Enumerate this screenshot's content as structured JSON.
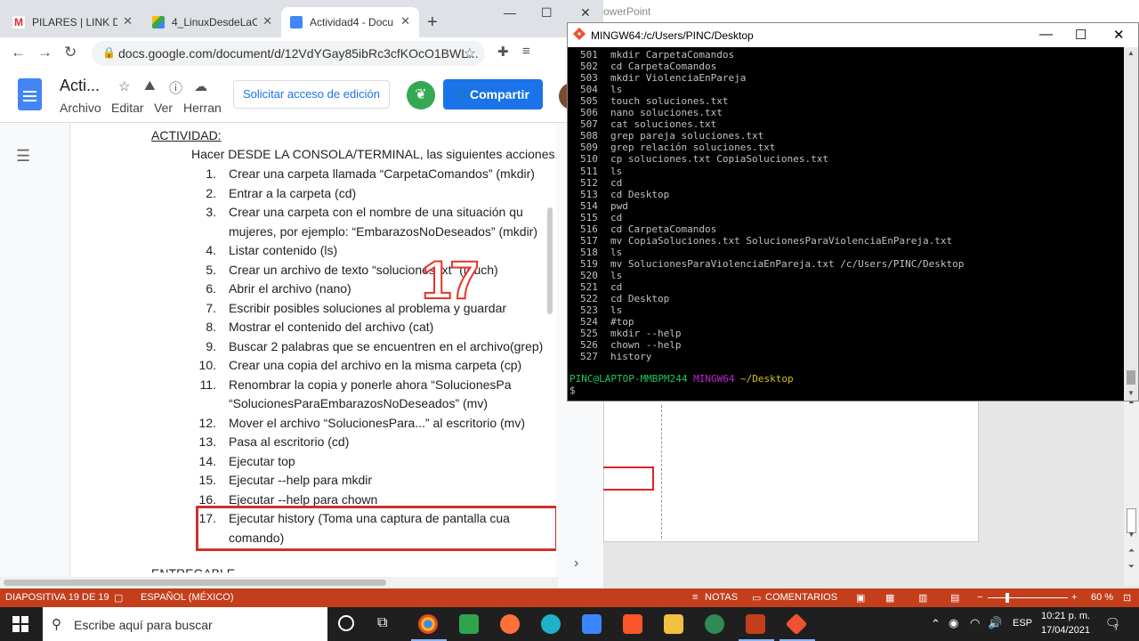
{
  "chrome": {
    "tabs": [
      {
        "label": "PILARES | LINK DE",
        "icon": "gmail-icon",
        "color": "#d93025",
        "active": false
      },
      {
        "label": "4_LinuxDesdeLaCo",
        "icon": "drive-icon",
        "color": "#34a853",
        "active": false
      },
      {
        "label": "Actividad4 - Docu",
        "icon": "docs-icon",
        "color": "#4285f4",
        "active": true
      }
    ],
    "new_tab": "+",
    "url": "docs.google.com/document/d/12VdYGay85ibRc3cfKOcO1BWL..."
  },
  "docs": {
    "title": "Acti...",
    "menus": [
      "Archivo",
      "Editar",
      "Ver",
      "Herran"
    ],
    "request_edit_label": "Solicitar acceso de edición",
    "share_label": "Compartir",
    "activity_title": "ACTIVIDAD:",
    "intro": "Hacer DESDE LA CONSOLA/TERMINAL, las siguientes acciones:",
    "items": [
      {
        "num": "1.",
        "lines": [
          "Crear una carpeta llamada “CarpetaComandos” (mkdir)"
        ]
      },
      {
        "num": "2.",
        "lines": [
          "Entrar a la carpeta (cd)"
        ]
      },
      {
        "num": "3.",
        "lines": [
          "Crear una carpeta con el nombre de una situación qu",
          "mujeres, por ejemplo: “EmbarazosNoDeseados” (mkdir)"
        ]
      },
      {
        "num": "4.",
        "lines": [
          "Listar contenido (ls)"
        ]
      },
      {
        "num": "5.",
        "lines": [
          "Crear un archivo de texto “soluciones.txt” (touch)"
        ]
      },
      {
        "num": "6.",
        "lines": [
          "Abrir el archivo (nano)"
        ]
      },
      {
        "num": "7.",
        "lines": [
          "Escribir posibles soluciones al problema y guardar"
        ]
      },
      {
        "num": "8.",
        "lines": [
          "Mostrar el contenido del archivo (cat)"
        ]
      },
      {
        "num": "9.",
        "lines": [
          "Buscar 2 palabras que se encuentren en el archivo(grep)"
        ]
      },
      {
        "num": "10.",
        "lines": [
          "Crear una copia del archivo en la misma carpeta (cp)"
        ]
      },
      {
        "num": "11.",
        "lines": [
          "Renombrar la copia y ponerle ahora “SolucionesPa",
          "“SolucionesParaEmbarazosNoDeseados” (mv)"
        ]
      },
      {
        "num": "12.",
        "lines": [
          "Mover el archivo “SolucionesPara...” al escritorio (mv)"
        ]
      },
      {
        "num": "13.",
        "lines": [
          "Pasa al escritorio (cd)"
        ]
      },
      {
        "num": "14.",
        "lines": [
          "Ejecutar top"
        ]
      },
      {
        "num": "15.",
        "lines": [
          "Ejecutar --help para mkdir"
        ]
      },
      {
        "num": "16.",
        "lines": [
          "Ejecutar --help para chown"
        ]
      },
      {
        "num": "17.",
        "lines": [
          "Ejecutar history (Toma una captura de pantalla cua",
          "comando)"
        ]
      }
    ],
    "overlay_number": "17",
    "entregable": "ENTREGABLE"
  },
  "terminal": {
    "title": "MINGW64:/c/Users/PINC/Desktop",
    "history": [
      {
        "n": "501",
        "cmd": "mkdir CarpetaComandos"
      },
      {
        "n": "502",
        "cmd": "cd CarpetaComandos"
      },
      {
        "n": "503",
        "cmd": "mkdir ViolenciaEnPareja"
      },
      {
        "n": "504",
        "cmd": "ls"
      },
      {
        "n": "505",
        "cmd": "touch soluciones.txt"
      },
      {
        "n": "506",
        "cmd": "nano soluciones.txt"
      },
      {
        "n": "507",
        "cmd": "cat soluciones.txt"
      },
      {
        "n": "508",
        "cmd": "grep pareja soluciones.txt"
      },
      {
        "n": "509",
        "cmd": "grep relación soluciones.txt"
      },
      {
        "n": "510",
        "cmd": "cp soluciones.txt CopiaSoluciones.txt"
      },
      {
        "n": "511",
        "cmd": "ls"
      },
      {
        "n": "512",
        "cmd": "cd"
      },
      {
        "n": "513",
        "cmd": "cd Desktop"
      },
      {
        "n": "514",
        "cmd": "pwd"
      },
      {
        "n": "515",
        "cmd": "cd"
      },
      {
        "n": "516",
        "cmd": "cd CarpetaComandos"
      },
      {
        "n": "517",
        "cmd": "mv CopiaSoluciones.txt SolucionesParaViolenciaEnPareja.txt"
      },
      {
        "n": "518",
        "cmd": "ls"
      },
      {
        "n": "519",
        "cmd": "mv SolucionesParaViolenciaEnPareja.txt /c/Users/PINC/Desktop"
      },
      {
        "n": "520",
        "cmd": "ls"
      },
      {
        "n": "521",
        "cmd": "cd"
      },
      {
        "n": "522",
        "cmd": "cd Desktop"
      },
      {
        "n": "523",
        "cmd": "ls"
      },
      {
        "n": "524",
        "cmd": "#top"
      },
      {
        "n": "525",
        "cmd": "mkdir --help"
      },
      {
        "n": "526",
        "cmd": "chown --help"
      },
      {
        "n": "527",
        "cmd": "history"
      }
    ],
    "prompt_user": "PINC@LAPTOP-MMBPM244",
    "prompt_env": "MINGW64",
    "prompt_path": "~/Desktop",
    "prompt_symbol": "$",
    "colors": {
      "user": "#22c55e",
      "env": "#c026d3",
      "path": "#d4c21a",
      "text": "#c0c0c0"
    }
  },
  "powerpoint": {
    "title_fragment": "owerPoint",
    "status": {
      "slide": "DIAPOSITIVA 19 DE 19",
      "language": "ESPAÑOL (MÉXICO)",
      "notes": "NOTAS",
      "comments": "COMENTARIOS",
      "zoom": "60 %"
    }
  },
  "taskbar": {
    "search_placeholder": "Escribe aquí para buscar",
    "language": "ESP",
    "time": "10:21 p. m.",
    "date": "17/04/2021",
    "notifications": "7"
  }
}
